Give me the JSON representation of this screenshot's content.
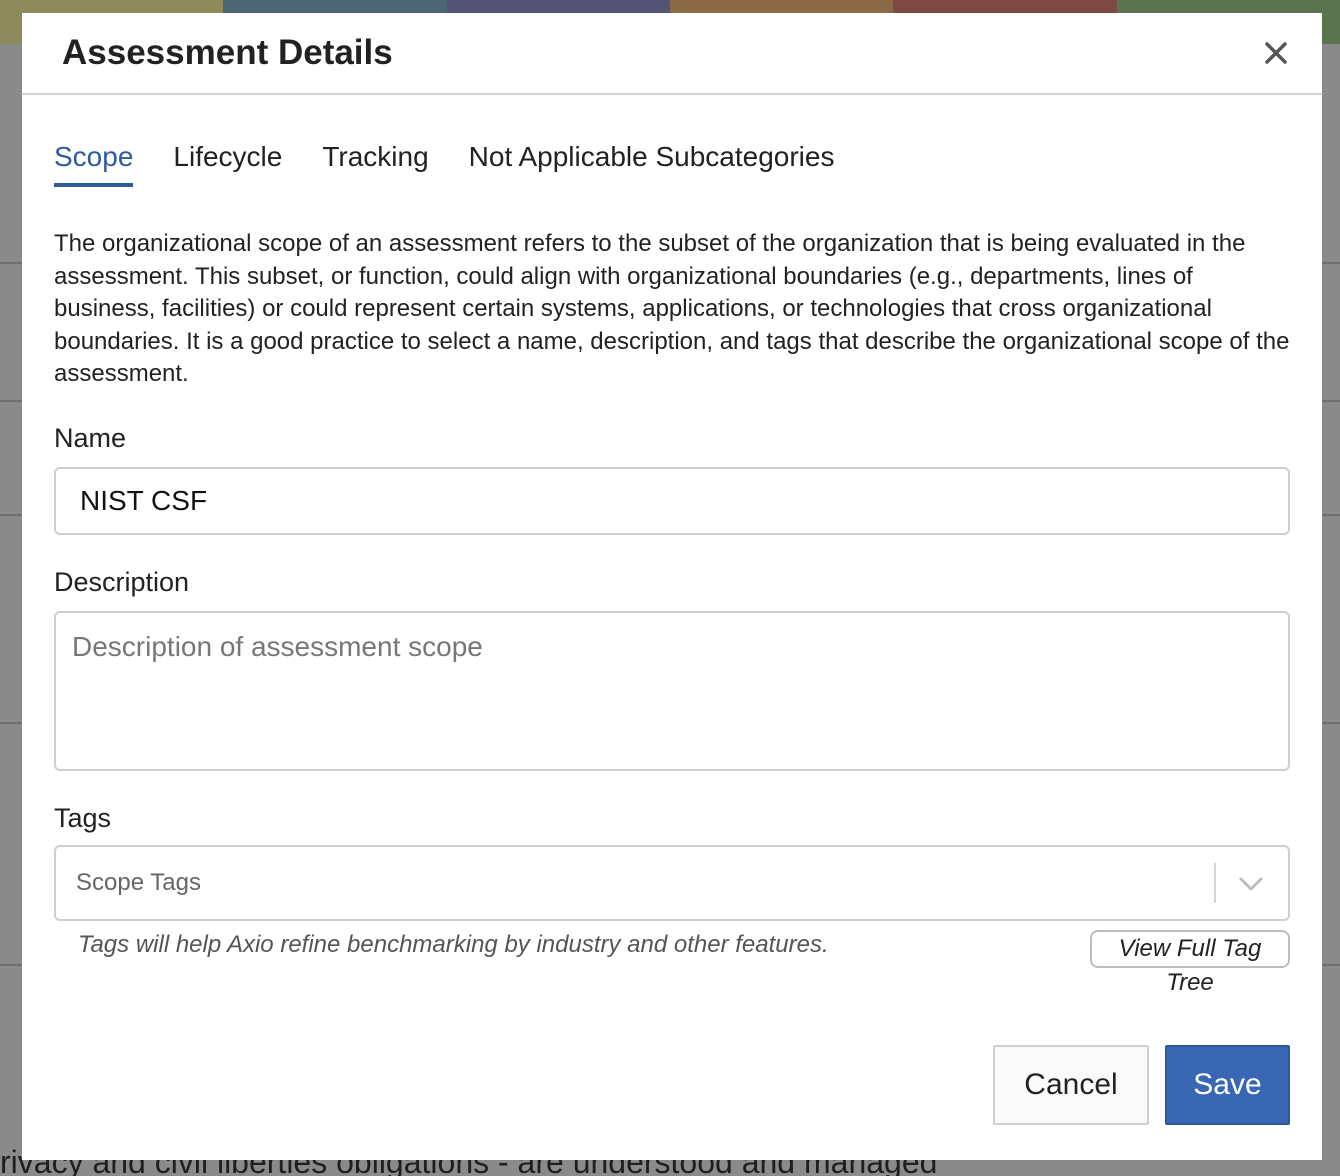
{
  "modal": {
    "title": "Assessment Details",
    "close_icon": "close-icon"
  },
  "tabs": [
    {
      "label": "Scope",
      "active": true
    },
    {
      "label": "Lifecycle",
      "active": false
    },
    {
      "label": "Tracking",
      "active": false
    },
    {
      "label": "Not Applicable Subcategories",
      "active": false
    }
  ],
  "scope": {
    "intro": "The organizational scope of an assessment refers to the subset of the organization that is being evaluated in the assessment. This subset, or function, could align with organizational boundaries (e.g., departments, lines of business, facilities) or could represent certain systems, applications, or technologies that cross organizational boundaries. It is a good practice to select a name, description, and tags that describe the organizational scope of the assessment.",
    "name_label": "Name",
    "name_value": "NIST CSF",
    "description_label": "Description",
    "description_placeholder": "Description of assessment scope",
    "tags_label": "Tags",
    "tags_placeholder": "Scope Tags",
    "tags_help": "Tags will help Axio refine benchmarking by industry and other features.",
    "view_tag_tree_label": "View Full Tag Tree"
  },
  "footer": {
    "cancel_label": "Cancel",
    "save_label": "Save"
  },
  "background": {
    "bottom_text": "rivacy and civil liberties obligations - are understood and managed",
    "top_bar_colors": [
      "#b5a855",
      "#4d7590",
      "#5b5a8f",
      "#b07f3e",
      "#a0453d",
      "#5b8a4f"
    ]
  },
  "colors": {
    "accent": "#2e5b9c",
    "save_button": "#3a67b4"
  }
}
